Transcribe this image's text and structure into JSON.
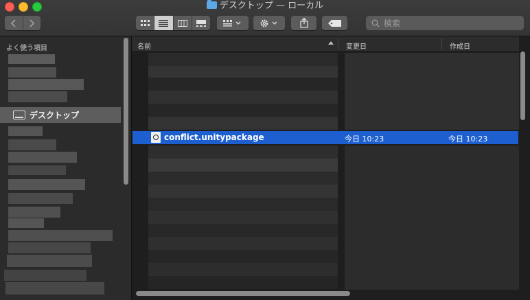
{
  "window": {
    "title": "デスクトップ — ローカル"
  },
  "toolbar": {
    "back_icon": "chevron-left-icon",
    "forward_icon": "chevron-right-icon",
    "view_modes": [
      "icon-view-icon",
      "list-view-icon",
      "column-view-icon",
      "gallery-view-icon"
    ],
    "active_view": "list-view-icon",
    "group_icon": "group-icon",
    "action_icon": "gear-icon",
    "share_icon": "share-icon",
    "tag_icon": "tag-icon",
    "search_placeholder": "検索"
  },
  "sidebar": {
    "section_label": "よく使う項目",
    "selected_item": "デスクトップ"
  },
  "list": {
    "columns": {
      "name": "名前",
      "modified": "変更日",
      "created": "作成日"
    },
    "selected_row": {
      "name": "conflict.unitypackage",
      "modified": "今日 10:23",
      "created": "今日 10:23"
    }
  },
  "colors": {
    "selection": "#1e5fd0",
    "close": "#fe5f57",
    "minimize": "#febc2e",
    "maximize": "#28c840"
  }
}
